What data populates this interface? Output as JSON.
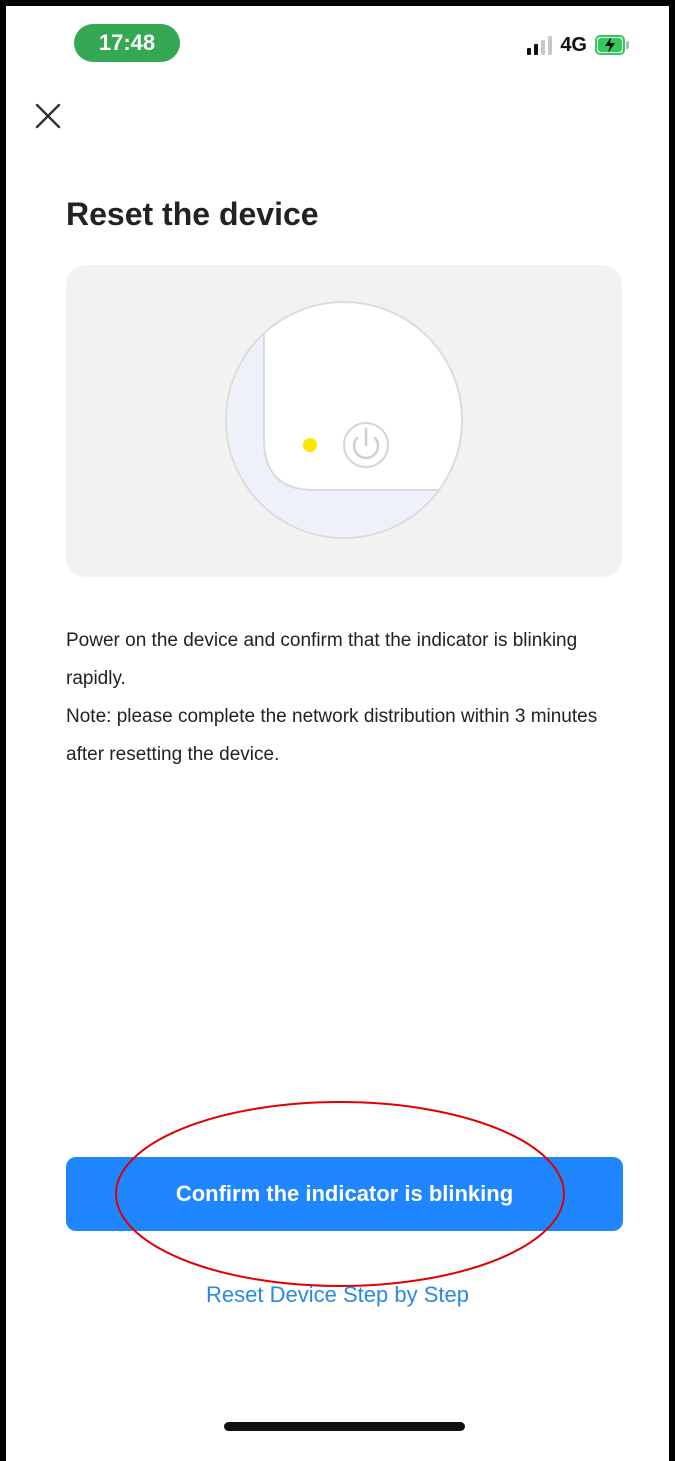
{
  "status_bar": {
    "time": "17:48",
    "network": "4G",
    "signal_bars_active": 2,
    "signal_bars_total": 4,
    "battery_state": "charging"
  },
  "header": {
    "close_icon": "close-icon"
  },
  "main": {
    "title": "Reset the device",
    "illustration": {
      "indicator_color": "#ffe600",
      "power_icon": "power-icon"
    },
    "description": {
      "line1": "Power on the device and confirm that the indicator is blinking rapidly.",
      "line2": "Note: please complete the network distribution within 3 minutes after resetting the device."
    },
    "confirm_button_label": "Confirm the indicator is blinking",
    "step_link_label": "Reset Device Step by Step"
  },
  "colors": {
    "primary_blue": "#1f86ff",
    "link_blue": "#2a88e6",
    "time_pill_green": "#34a853",
    "annotation_red": "#e00000",
    "card_background": "#f2f2f2"
  }
}
